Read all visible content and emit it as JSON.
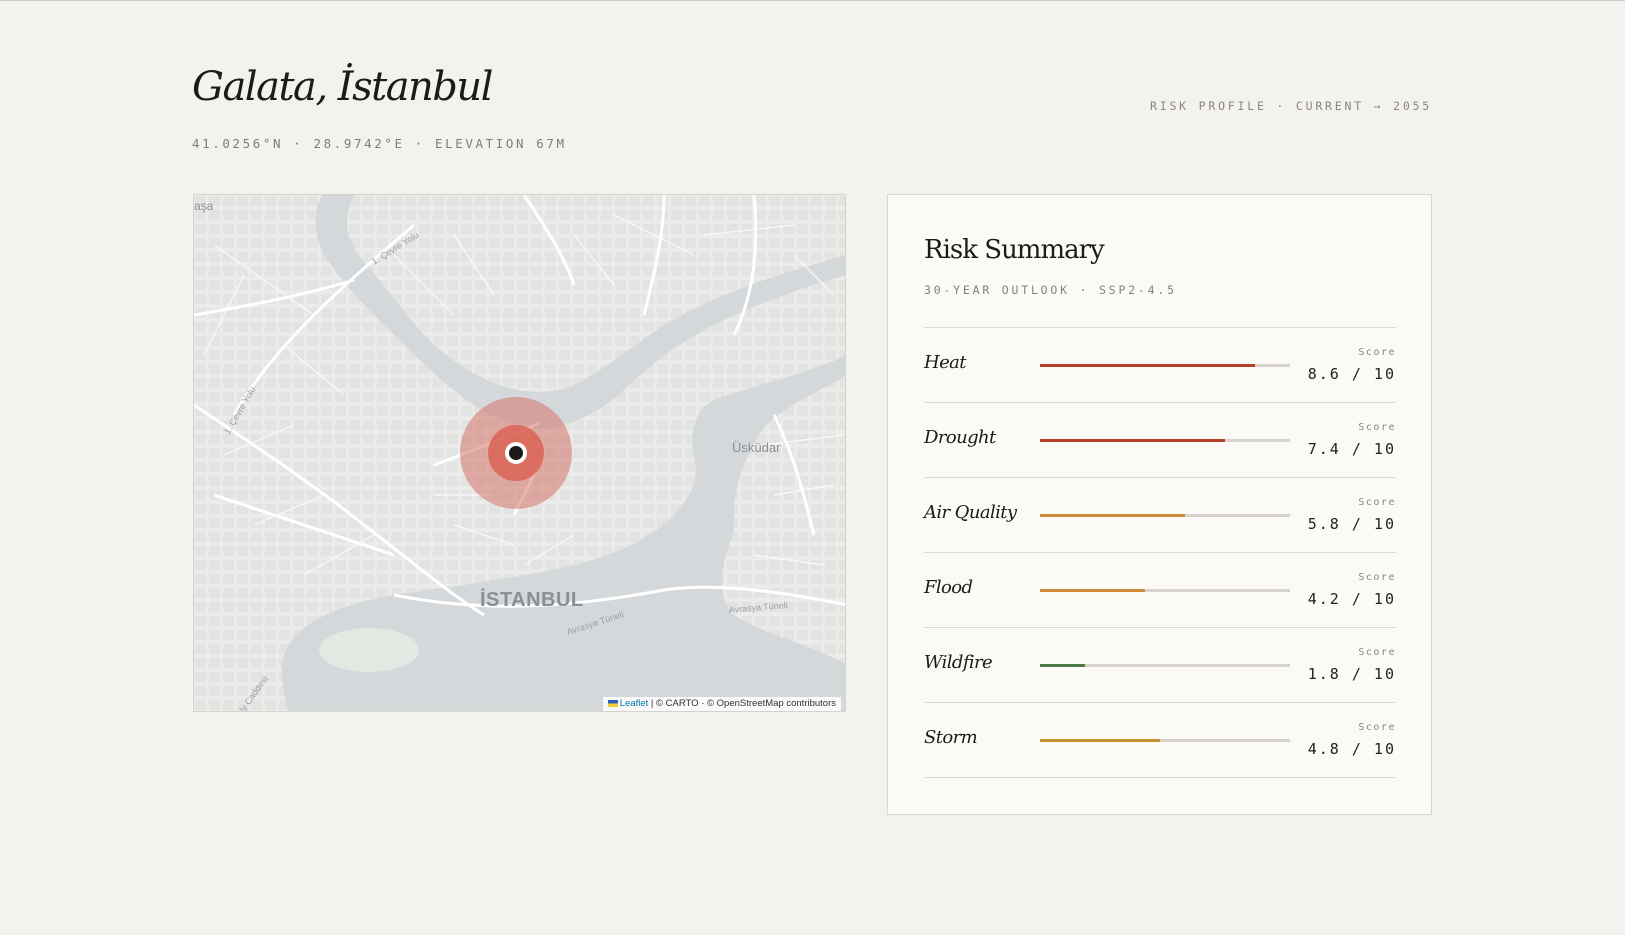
{
  "location": {
    "title": "Galata, İstanbul",
    "coords_line": "41.0256°N · 28.9742°E · ELEVATION 67M",
    "profile_label": "RISK PROFILE · CURRENT → 2055"
  },
  "map": {
    "labels": {
      "city": "İSTANBUL",
      "district": "Üsküdar",
      "corner": "aşa",
      "road_cevre_top": "1. Çevre Yolu",
      "road_cevre_left": "1. Çevre Yolu",
      "tunnel_left": "Avrasya Tüneli",
      "tunnel_right": "Avrasya Tüneli",
      "road_bottom": "ly Caddesi"
    },
    "attribution": {
      "leaflet": "Leaflet",
      "rest": "| © CARTO · © OpenStreetMap contributors"
    }
  },
  "summary": {
    "title": "Risk Summary",
    "subtitle": "30-YEAR OUTLOOK · SSP2-4.5",
    "score_label": "Score",
    "risks": [
      {
        "name": "Heat",
        "score": 8.6,
        "display": "8.6 / 10",
        "color": "#b5402a"
      },
      {
        "name": "Drought",
        "score": 7.4,
        "display": "7.4 / 10",
        "color": "#b5402a"
      },
      {
        "name": "Air Quality",
        "score": 5.8,
        "display": "5.8 / 10",
        "color": "#cc8a36"
      },
      {
        "name": "Flood",
        "score": 4.2,
        "display": "4.2 / 10",
        "color": "#cc8a36"
      },
      {
        "name": "Wildfire",
        "score": 1.8,
        "display": "1.8 / 10",
        "color": "#4e7a45"
      },
      {
        "name": "Storm",
        "score": 4.8,
        "display": "4.8 / 10",
        "color": "#c49030"
      }
    ]
  }
}
